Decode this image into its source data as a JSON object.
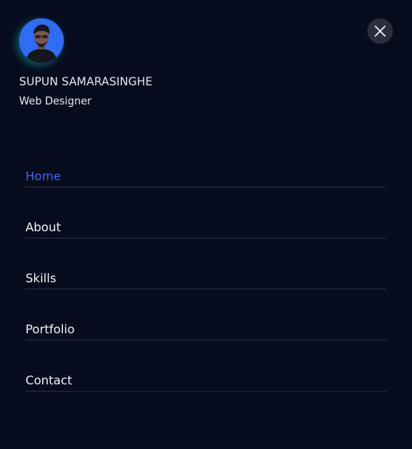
{
  "profile": {
    "avatar_icon": "person-photo-icon",
    "name": "SUPUN SAMARASINGHE",
    "role": "Web Designer"
  },
  "close_button": {
    "icon": "close-icon"
  },
  "nav": {
    "items": [
      {
        "label": "Home",
        "active": true
      },
      {
        "label": "About",
        "active": false
      },
      {
        "label": "Skills",
        "active": false
      },
      {
        "label": "Portfolio",
        "active": false
      },
      {
        "label": "Contact",
        "active": false
      }
    ]
  },
  "colors": {
    "background": "#070b1e",
    "accent": "#3466f5",
    "text": "#f1f2f6",
    "divider": "#262b3e",
    "avatar_bg": "#2e6cf4",
    "close_bg": "#2b2f3d"
  }
}
